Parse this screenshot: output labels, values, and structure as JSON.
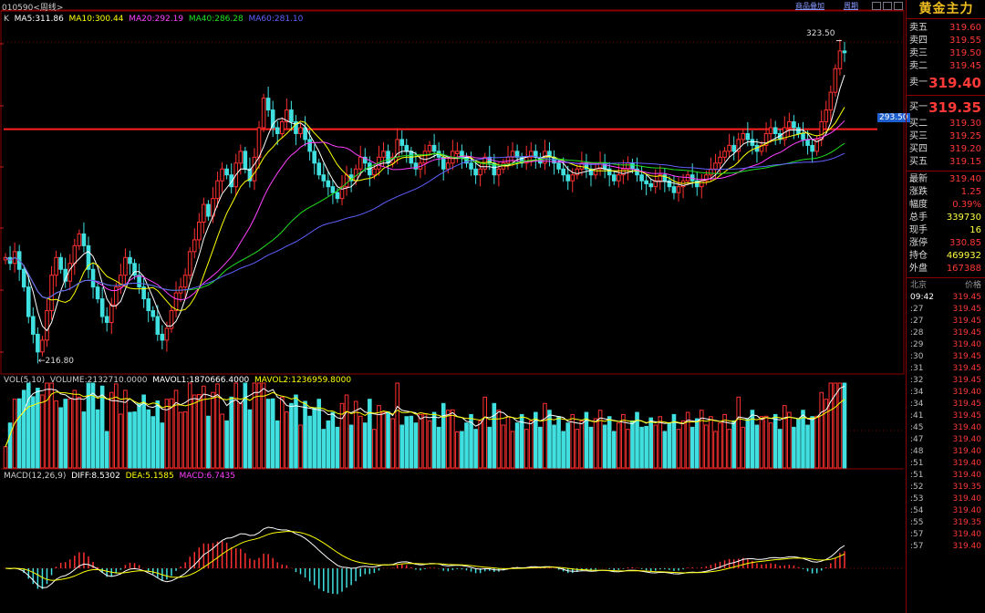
{
  "top_bar": {
    "symbol": "010590",
    "period": "周线",
    "product_overlay": "商品叠加",
    "period_btn": "周期"
  },
  "ma_legend": {
    "k": "K",
    "ma5": "MA5:311.86",
    "ma10": "MA10:300.44",
    "ma20": "MA20:292.19",
    "ma40": "MA40:286.28",
    "ma60": "MA60:281.10",
    "colors": {
      "ma5": "#ffffff",
      "ma10": "#ffff00",
      "ma20": "#ff40ff",
      "ma40": "#20e020",
      "ma60": "#6060ff"
    }
  },
  "price_annotations": {
    "high": "323.50",
    "low": "216.80",
    "marker": "293.50"
  },
  "vol_legend": {
    "label": "VOL(5,10)",
    "volume": "VOLUME:2132710.0000",
    "mavol1": "MAVOL1:1870666.4000",
    "mavol2": "MAVOL2:1236959.8000"
  },
  "macd_legend": {
    "label": "MACD(12,26,9)",
    "diff": "DIFF:8.5302",
    "dea": "DEA:5.1585",
    "macd": "MACD:6.7435"
  },
  "right_panel": {
    "title": "黄金主力",
    "asks": [
      {
        "label": "卖五",
        "price": "319.60"
      },
      {
        "label": "卖四",
        "price": "319.55"
      },
      {
        "label": "卖三",
        "price": "319.50"
      },
      {
        "label": "卖二",
        "price": "319.45"
      }
    ],
    "ask1": {
      "label": "卖一",
      "price": "319.40"
    },
    "bid1": {
      "label": "买一",
      "price": "319.35"
    },
    "bids": [
      {
        "label": "买二",
        "price": "319.30"
      },
      {
        "label": "买三",
        "price": "319.25"
      },
      {
        "label": "买四",
        "price": "319.20"
      },
      {
        "label": "买五",
        "price": "319.15"
      }
    ],
    "stats": [
      {
        "label": "最新",
        "value": "319.40",
        "color": "#ff3838"
      },
      {
        "label": "涨跌",
        "value": "1.25",
        "color": "#ff3838"
      },
      {
        "label": "幅度",
        "value": "0.39%",
        "color": "#ff3838"
      },
      {
        "label": "总手",
        "value": "339730",
        "color": "#ffff40"
      },
      {
        "label": "现手",
        "value": "16",
        "color": "#ffff40"
      },
      {
        "label": "涨停",
        "value": "330.85",
        "color": "#ff3838"
      },
      {
        "label": "持仓",
        "value": "469932",
        "color": "#ffff40"
      },
      {
        "label": "外盘",
        "value": "167388",
        "color": "#ff3838"
      }
    ],
    "ticks_header": {
      "time": "北京",
      "price": "价格"
    },
    "ticks": [
      {
        "t": "09:42",
        "p": "319.45"
      },
      {
        "t": ":27",
        "p": "319.45"
      },
      {
        "t": ":27",
        "p": "319.45"
      },
      {
        "t": ":28",
        "p": "319.45"
      },
      {
        "t": ":29",
        "p": "319.40"
      },
      {
        "t": ":30",
        "p": "319.45"
      },
      {
        "t": ":31",
        "p": "319.45"
      },
      {
        "t": ":32",
        "p": "319.45"
      },
      {
        "t": ":34",
        "p": "319.40"
      },
      {
        "t": ":34",
        "p": "319.45"
      },
      {
        "t": ":41",
        "p": "319.45"
      },
      {
        "t": ":45",
        "p": "319.40"
      },
      {
        "t": ":47",
        "p": "319.40"
      },
      {
        "t": ":48",
        "p": "319.40"
      },
      {
        "t": ":51",
        "p": "319.40"
      },
      {
        "t": ":51",
        "p": "319.40"
      },
      {
        "t": ":52",
        "p": "319.35"
      },
      {
        "t": ":53",
        "p": "319.40"
      },
      {
        "t": ":54",
        "p": "319.40"
      },
      {
        "t": ":55",
        "p": "319.35"
      },
      {
        "t": ":57",
        "p": "319.40"
      },
      {
        "t": ":57",
        "p": "319.40"
      }
    ]
  },
  "chart_data": {
    "type": "candlestick",
    "instrument": "黄金主力",
    "period": "周线",
    "price_range": [
      213,
      328
    ],
    "key_levels": {
      "high": 323.5,
      "low": 216.8,
      "marker_line": 293.5
    },
    "closes": [
      250,
      248,
      252,
      246,
      240,
      230,
      224,
      218,
      222,
      232,
      244,
      250,
      246,
      242,
      248,
      254,
      258,
      254,
      246,
      240,
      236,
      230,
      228,
      234,
      240,
      244,
      250,
      248,
      244,
      240,
      236,
      232,
      230,
      224,
      222,
      226,
      232,
      238,
      240,
      244,
      252,
      256,
      262,
      268,
      264,
      270,
      276,
      280,
      278,
      274,
      282,
      286,
      280,
      276,
      284,
      294,
      304,
      300,
      294,
      292,
      296,
      300,
      296,
      292,
      294,
      290,
      286,
      282,
      278,
      276,
      274,
      272,
      270,
      274,
      278,
      276,
      280,
      284,
      282,
      278,
      280,
      284,
      286,
      282,
      284,
      290,
      288,
      286,
      282,
      280,
      282,
      286,
      288,
      286,
      284,
      280,
      282,
      286,
      286,
      284,
      282,
      280,
      278,
      280,
      284,
      282,
      278,
      280,
      282,
      284,
      286,
      284,
      282,
      284,
      286,
      284,
      282,
      286,
      284,
      282,
      280,
      278,
      276,
      278,
      280,
      282,
      280,
      278,
      280,
      282,
      280,
      278,
      276,
      278,
      280,
      282,
      280,
      278,
      276,
      275,
      274,
      276,
      278,
      276,
      274,
      272,
      274,
      276,
      278,
      276,
      274,
      276,
      278,
      280,
      282,
      284,
      286,
      288,
      286,
      290,
      292,
      290,
      288,
      286,
      288,
      292,
      294,
      292,
      290,
      294,
      296,
      294,
      292,
      290,
      288,
      286,
      290,
      296,
      300,
      306,
      314,
      320,
      319.4
    ],
    "ma5_last": 311.86,
    "ma10_last": 300.44,
    "ma20_last": 292.19,
    "ma40_last": 286.28,
    "ma60_last": 281.1,
    "volume_last": 2132710,
    "mavol1_last": 1870666.4,
    "mavol2_last": 1236959.8,
    "macd": {
      "diff_last": 8.5302,
      "dea_last": 5.1585,
      "macd_last": 6.7435
    }
  }
}
